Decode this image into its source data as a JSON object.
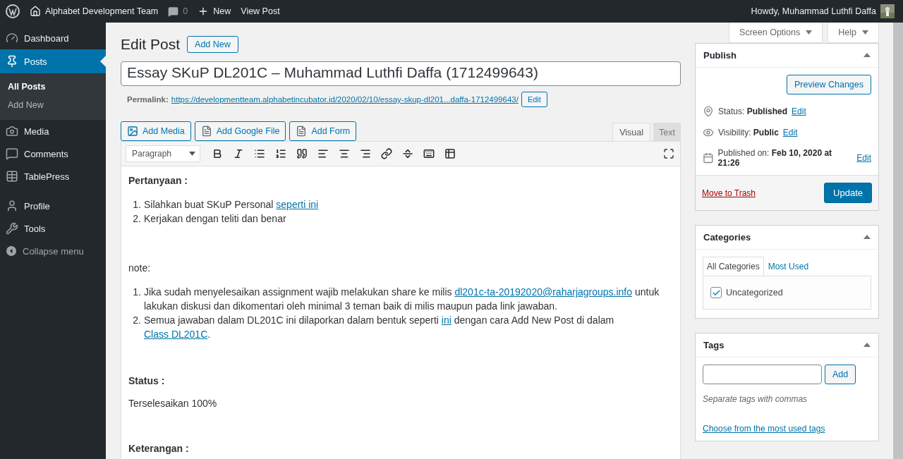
{
  "admin_bar": {
    "site_name": "Alphabet Development Team",
    "comments_count": "0",
    "new_label": "New",
    "view_label": "View Post",
    "greeting": "Howdy, Muhammad Luthfi Daffa"
  },
  "sidebar": {
    "items": [
      {
        "label": "Dashboard",
        "selected": false
      },
      {
        "label": "Posts",
        "selected": true,
        "children": [
          {
            "label": "All Posts",
            "selected": true
          },
          {
            "label": "Add New",
            "selected": false
          }
        ]
      },
      {
        "label": "Media",
        "selected": false
      },
      {
        "label": "Comments",
        "selected": false
      },
      {
        "label": "TablePress",
        "selected": false
      },
      {
        "label": "Profile",
        "selected": false
      },
      {
        "label": "Tools",
        "selected": false
      }
    ],
    "collapse_label": "Collapse menu"
  },
  "screen_buttons": [
    "Screen Options",
    "Help"
  ],
  "page": {
    "title": "Edit Post",
    "add_new": "Add New"
  },
  "post": {
    "title": "Essay SKuP DL201C – Muhammad Luthfi Daffa (1712499643)",
    "permalink_label": "Permalink:",
    "permalink": "https://developmentteam.alphabetincubator.id/2020/02/10/essay-skup-dl201...daffa-1712499643/",
    "permalink_edit": "Edit"
  },
  "media_buttons": [
    "Add Media",
    "Add Google File",
    "Add Form"
  ],
  "editor_tabs": [
    {
      "label": "Visual",
      "selected": true
    },
    {
      "label": "Text",
      "selected": false
    }
  ],
  "format_select": "Paragraph",
  "content": [
    {
      "kind": "heading",
      "text": "Pertanyaan :"
    },
    {
      "kind": "list",
      "items": [
        {
          "marker": "1.",
          "segments": [
            {
              "kind": "text",
              "text": "Silahkan buat SKuP Personal "
            },
            {
              "kind": "link",
              "text": "seperti ini"
            }
          ]
        },
        {
          "marker": "2.",
          "segments": [
            {
              "kind": "text",
              "text": "Kerjakan dengan teliti dan benar"
            }
          ]
        }
      ]
    },
    {
      "kind": "paragraph",
      "text": "note:"
    },
    {
      "kind": "list",
      "items": [
        {
          "marker": "1.",
          "segments": [
            {
              "kind": "text",
              "text": "Jika sudah menyelesaikan assignment wajib melakukan share ke milis "
            },
            {
              "kind": "link",
              "text": "dl201c-ta-20192020@raharjagroups.info"
            },
            {
              "kind": "text",
              "text": " untuk lakukan diskusi dan dikomentari oleh minimal 3 teman baik di milis maupun pada link jawaban."
            }
          ]
        },
        {
          "marker": "2.",
          "segments": [
            {
              "kind": "text",
              "text": "Semua jawaban dalam DL201C ini dilaporkan dalam bentuk seperti "
            },
            {
              "kind": "link",
              "text": "ini"
            },
            {
              "kind": "text",
              "text": " dengan cara Add New Post di dalam "
            },
            {
              "kind": "link",
              "text": "Class DL201C"
            },
            {
              "kind": "text",
              "text": "."
            }
          ]
        }
      ]
    },
    {
      "kind": "heading",
      "text": "Status :"
    },
    {
      "kind": "paragraph",
      "text": "Terselesaikan 100%"
    },
    {
      "kind": "heading",
      "text": "Keterangan :"
    }
  ],
  "publish": {
    "title": "Publish",
    "preview": "Preview Changes",
    "rows": [
      {
        "label": "Status:",
        "value": "Published",
        "edit": "Edit"
      },
      {
        "label": "Visibility:",
        "value": "Public",
        "edit": "Edit"
      },
      {
        "label": "Published on:",
        "value": "Feb 10, 2020 at 21:26",
        "edit": "Edit"
      }
    ],
    "trash": "Move to Trash",
    "update": "Update"
  },
  "categories": {
    "title": "Categories",
    "tabs": [
      {
        "label": "All Categories",
        "selected": true
      },
      {
        "label": "Most Used",
        "selected": false
      }
    ],
    "items": [
      {
        "label": "Uncategorized",
        "checked": true
      }
    ]
  },
  "tags": {
    "title": "Tags",
    "add": "Add",
    "hint": "Separate tags with commas",
    "choose": "Choose from the most used tags"
  }
}
